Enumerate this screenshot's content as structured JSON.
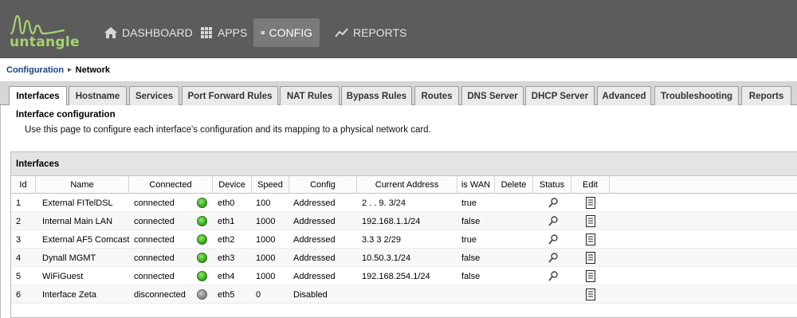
{
  "app": {
    "logo_text": "untangle",
    "nav": [
      {
        "label": "DASHBOARD",
        "icon": "home-icon"
      },
      {
        "label": "APPS",
        "icon": "grid-icon"
      },
      {
        "label": "CONFIG",
        "icon": "sliders-icon",
        "active": true
      },
      {
        "label": "REPORTS",
        "icon": "chart-line-icon"
      }
    ]
  },
  "breadcrumb": {
    "parent": "Configuration",
    "current": "Network"
  },
  "tabs": [
    {
      "label": "Interfaces",
      "active": true
    },
    {
      "label": "Hostname"
    },
    {
      "label": "Services"
    },
    {
      "label": "Port Forward Rules"
    },
    {
      "label": "NAT Rules"
    },
    {
      "label": "Bypass Rules"
    },
    {
      "label": "Routes"
    },
    {
      "label": "DNS Server"
    },
    {
      "label": "DHCP Server"
    },
    {
      "label": "Advanced"
    },
    {
      "label": "Troubleshooting"
    },
    {
      "label": "Reports"
    }
  ],
  "section": {
    "title": "Interface configuration",
    "description": "Use this page to configure each interface's configuration and its mapping to a physical network card."
  },
  "grid": {
    "title": "Interfaces",
    "columns": [
      "Id",
      "Name",
      "Connected",
      "Device",
      "Speed",
      "Config",
      "Current Address",
      "is WAN",
      "Delete",
      "Status",
      "Edit"
    ],
    "rows": [
      {
        "id": "1",
        "name": "External FITelDSL",
        "connected": "connected",
        "led": "green",
        "device": "eth0",
        "speed": "100",
        "config": "Addressed",
        "address": "2 . . 9. 3/24",
        "is_wan": "true",
        "status_icon": true
      },
      {
        "id": "2",
        "name": "Internal Main LAN",
        "connected": "connected",
        "led": "green",
        "device": "eth1",
        "speed": "1000",
        "config": "Addressed",
        "address": "192.168.1.1/24",
        "is_wan": "false",
        "status_icon": true
      },
      {
        "id": "3",
        "name": "External AF5 Comcast",
        "connected": "connected",
        "led": "green",
        "device": "eth2",
        "speed": "1000",
        "config": "Addressed",
        "address": "3.3 3 2/29",
        "is_wan": "true",
        "status_icon": true
      },
      {
        "id": "4",
        "name": "Dynall MGMT",
        "connected": "connected",
        "led": "green",
        "device": "eth3",
        "speed": "1000",
        "config": "Addressed",
        "address": "10.50.3.1/24",
        "is_wan": "false",
        "status_icon": true
      },
      {
        "id": "5",
        "name": "WiFiGuest",
        "connected": "connected",
        "led": "green",
        "device": "eth4",
        "speed": "1000",
        "config": "Addressed",
        "address": "192.168.254.1/24",
        "is_wan": "false",
        "status_icon": true
      },
      {
        "id": "6",
        "name": "Interface Zeta",
        "connected": "disconnected",
        "led": "gray",
        "device": "eth5",
        "speed": "0",
        "config": "Disabled",
        "address": "",
        "is_wan": "",
        "status_icon": false
      }
    ]
  },
  "colors": {
    "topbar": "#5c5c5c",
    "logo": "#a7d36f",
    "link": "#15428b",
    "led_connected": "#2f9e1a",
    "led_disconnected": "#7d7d7d"
  }
}
